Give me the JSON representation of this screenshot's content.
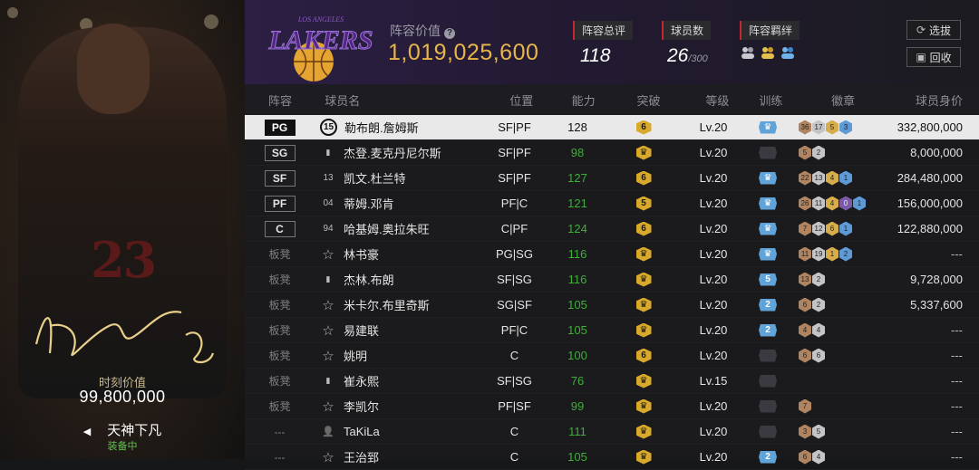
{
  "card": {
    "jersey_number": "23",
    "value_label": "时刻价值",
    "value": "99,800,000",
    "skin_name": "天神下凡",
    "equipped_label": "装备中"
  },
  "header": {
    "logo_text": "LAKERS",
    "logo_sub": "LOS ANGELES",
    "lineup_value_label": "阵容价值",
    "lineup_value": "1,019,025,600",
    "overall_label": "阵容总评",
    "overall_value": "118",
    "players_label": "球员数",
    "players_value": "26",
    "players_max": "/300",
    "bond_label": "阵容羁绊",
    "filter_button": "选拔",
    "recycle_button": "回收"
  },
  "columns": [
    "阵容",
    "球员名",
    "位置",
    "能力",
    "突破",
    "等级",
    "训练",
    "徽章",
    "球员身价"
  ],
  "rows": [
    {
      "slot": "PG",
      "bench": false,
      "num": "15",
      "name": "勒布朗.詹姆斯",
      "pos": "SF|PF",
      "ovr": "128",
      "brk": "6",
      "lvl": "Lv.20",
      "trn": "crown",
      "badges": [
        [
          "bronze",
          "36"
        ],
        [
          "silver",
          "17"
        ],
        [
          "gold",
          "5"
        ],
        [
          "blue",
          "3"
        ]
      ],
      "value": "332,800,000",
      "selected": true
    },
    {
      "slot": "SG",
      "bench": false,
      "num": "bars",
      "name": "杰登.麦克丹尼尔斯",
      "pos": "SF|PF",
      "ovr": "98",
      "brk": "crown",
      "lvl": "Lv.20",
      "trn": "empty",
      "badges": [
        [
          "bronze",
          "5"
        ],
        [
          "silver",
          "2"
        ]
      ],
      "value": "8,000,000"
    },
    {
      "slot": "SF",
      "bench": false,
      "num": "13",
      "name": "凯文.杜兰特",
      "pos": "SF|PF",
      "ovr": "127",
      "brk": "6",
      "lvl": "Lv.20",
      "trn": "crown",
      "badges": [
        [
          "bronze",
          "22"
        ],
        [
          "silver",
          "13"
        ],
        [
          "gold",
          "4"
        ],
        [
          "blue",
          "1"
        ]
      ],
      "value": "284,480,000"
    },
    {
      "slot": "PF",
      "bench": false,
      "num": "04",
      "name": "蒂姆.邓肯",
      "pos": "PF|C",
      "ovr": "121",
      "brk": "5",
      "lvl": "Lv.20",
      "trn": "crown",
      "badges": [
        [
          "bronze",
          "26"
        ],
        [
          "silver",
          "11"
        ],
        [
          "gold",
          "4"
        ],
        [
          "purple",
          "0"
        ],
        [
          "blue",
          "1"
        ]
      ],
      "value": "156,000,000"
    },
    {
      "slot": "C",
      "bench": false,
      "num": "94",
      "name": "哈基姆.奥拉朱旺",
      "pos": "C|PF",
      "ovr": "124",
      "brk": "6",
      "lvl": "Lv.20",
      "trn": "crown",
      "badges": [
        [
          "bronze",
          "7"
        ],
        [
          "silver",
          "12"
        ],
        [
          "gold",
          "6"
        ],
        [
          "blue",
          "1"
        ]
      ],
      "value": "122,880,000"
    },
    {
      "slot": "板凳",
      "bench": true,
      "num": "star",
      "name": "林书豪",
      "pos": "PG|SG",
      "ovr": "116",
      "brk": "crown",
      "lvl": "Lv.20",
      "trn": "crown",
      "badges": [
        [
          "bronze",
          "11"
        ],
        [
          "silver",
          "19"
        ],
        [
          "gold",
          "1"
        ],
        [
          "blue",
          "2"
        ]
      ],
      "value": "---"
    },
    {
      "slot": "板凳",
      "bench": true,
      "num": "bars",
      "name": "杰林.布朗",
      "pos": "SF|SG",
      "ovr": "116",
      "brk": "crown",
      "lvl": "Lv.20",
      "trn": "5",
      "badges": [
        [
          "bronze",
          "13"
        ],
        [
          "silver",
          "2"
        ]
      ],
      "value": "9,728,000"
    },
    {
      "slot": "板凳",
      "bench": true,
      "num": "star",
      "name": "米卡尔.布里奇斯",
      "pos": "SG|SF",
      "ovr": "105",
      "brk": "crown",
      "lvl": "Lv.20",
      "trn": "2",
      "badges": [
        [
          "bronze",
          "6"
        ],
        [
          "silver",
          "2"
        ]
      ],
      "value": "5,337,600"
    },
    {
      "slot": "板凳",
      "bench": true,
      "num": "star",
      "name": "易建联",
      "pos": "PF|C",
      "ovr": "105",
      "brk": "crown",
      "lvl": "Lv.20",
      "trn": "2",
      "badges": [
        [
          "bronze",
          "4"
        ],
        [
          "silver",
          "4"
        ]
      ],
      "value": "---"
    },
    {
      "slot": "板凳",
      "bench": true,
      "num": "star",
      "name": "姚明",
      "pos": "C",
      "ovr": "100",
      "brk": "6",
      "lvl": "Lv.20",
      "trn": "empty",
      "badges": [
        [
          "bronze",
          "6"
        ],
        [
          "silver",
          "6"
        ]
      ],
      "value": "---"
    },
    {
      "slot": "板凳",
      "bench": true,
      "num": "bars",
      "name": "崔永熙",
      "pos": "SF|SG",
      "ovr": "76",
      "brk": "crown",
      "lvl": "Lv.15",
      "trn": "empty",
      "badges": [],
      "value": "---"
    },
    {
      "slot": "板凳",
      "bench": true,
      "num": "star",
      "name": "李凯尔",
      "pos": "PF|SF",
      "ovr": "99",
      "brk": "crown",
      "lvl": "Lv.20",
      "trn": "empty",
      "badges": [
        [
          "bronze",
          "7"
        ]
      ],
      "value": "---"
    },
    {
      "slot": "---",
      "bench": true,
      "num": "person",
      "name": "TaKiLa",
      "pos": "C",
      "ovr": "111",
      "brk": "crown",
      "lvl": "Lv.20",
      "trn": "empty",
      "badges": [
        [
          "bronze",
          "3"
        ],
        [
          "silver",
          "5"
        ]
      ],
      "value": "---"
    },
    {
      "slot": "---",
      "bench": true,
      "num": "star",
      "name": "王治郅",
      "pos": "C",
      "ovr": "105",
      "brk": "crown",
      "lvl": "Lv.20",
      "trn": "2",
      "badges": [
        [
          "bronze",
          "6"
        ],
        [
          "silver",
          "4"
        ]
      ],
      "value": "---"
    }
  ],
  "colors": {
    "accent_gold": "#e7b64b",
    "lakers_purple": "#552583",
    "selected_row": "#e9e9ea",
    "ovr_green": "#3fae3a"
  }
}
